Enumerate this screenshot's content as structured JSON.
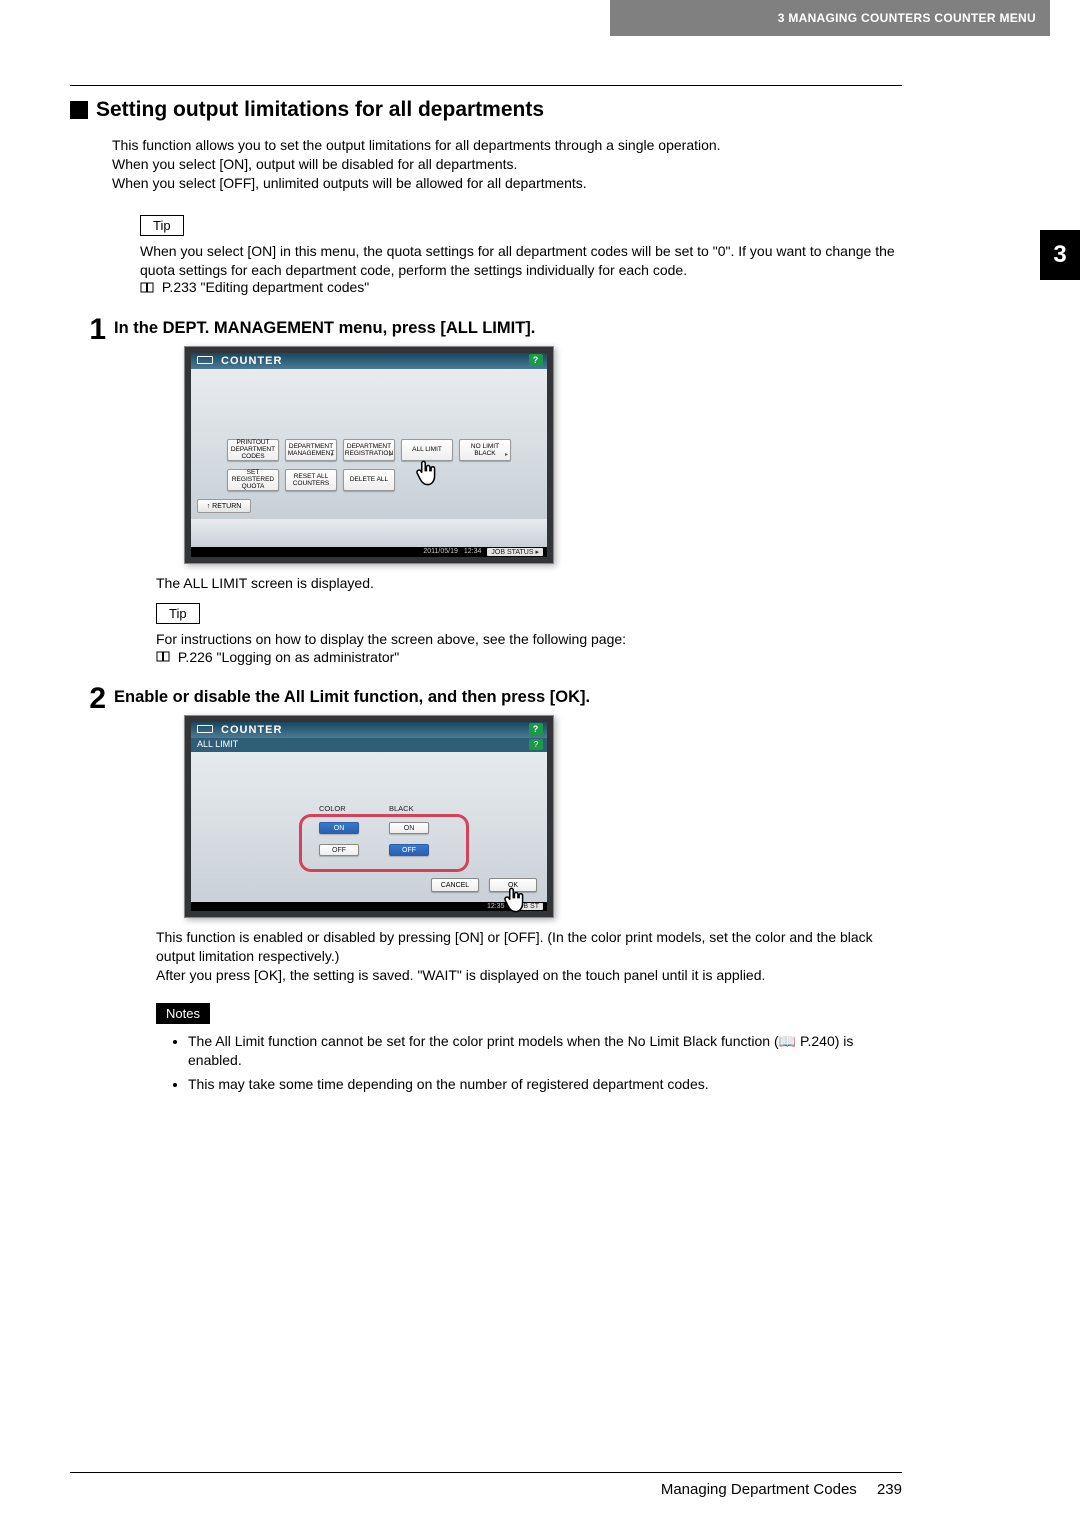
{
  "header": {
    "strip": "3 MANAGING COUNTERS COUNTER MENU",
    "chapter_tab": "3"
  },
  "section": {
    "title": "Setting output limitations for all departments",
    "intro_l1": "This function allows you to set the output limitations for all departments through a single operation.",
    "intro_l2": "When you select [ON], output will be disabled for all departments.",
    "intro_l3": "When you select [OFF], unlimited outputs will be allowed for all departments."
  },
  "tip_label": "Tip",
  "tip1": {
    "text": "When you select [ON] in this menu, the quota settings for all department codes will be set to \"0\". If you want to change the quota settings for each department code, perform the settings individually for each code.",
    "ref": "P.233 \"Editing department codes\""
  },
  "steps": [
    {
      "title": "In the DEPT. MANAGEMENT menu, press [ALL LIMIT].",
      "after": "The ALL LIMIT screen is displayed."
    },
    {
      "title": "Enable or disable the All Limit function, and then press [OK].",
      "after_l1": "This function is enabled or disabled by pressing [ON] or [OFF]. (In the color print models, set the color and the black output limitation respectively.)",
      "after_l2": "After you press [OK], the setting is saved. \"WAIT\" is displayed on the touch panel until it is applied."
    }
  ],
  "tip2": {
    "text": "For instructions on how to display the screen above, see the following page:",
    "ref": "P.226 \"Logging on as administrator\""
  },
  "notes_label": "Notes",
  "notes": [
    "The All Limit function cannot be set for the color print models when the No Limit Black function (📖 P.240) is enabled.",
    "This may take some time depending on the number of registered department codes."
  ],
  "mock1": {
    "title": "COUNTER",
    "help": "?",
    "buttons": {
      "printout": "PRINTOUT DEPARTMENT CODES",
      "dept_mgmt": "DEPARTMENT MANAGEMENT",
      "dept_reg": "DEPARTMENT REGISTRATION",
      "all_limit": "ALL LIMIT",
      "no_limit_black": "NO LIMIT BLACK",
      "set_reg_quota": "SET REGISTERED QUOTA",
      "reset_all": "RESET ALL COUNTERS",
      "delete_all": "DELETE ALL"
    },
    "return": "RETURN",
    "date": "2011/05/19",
    "time": "12:34",
    "job_status": "JOB STATUS"
  },
  "mock2": {
    "title": "COUNTER",
    "sub": "ALL LIMIT",
    "help": "?",
    "col_color": "COLOR",
    "col_black": "BLACK",
    "on": "ON",
    "off": "OFF",
    "cancel": "CANCEL",
    "ok": "OK",
    "time": "12:35",
    "job_status": "JOB ST"
  },
  "footer": {
    "text": "Managing Department Codes",
    "page": "239"
  }
}
